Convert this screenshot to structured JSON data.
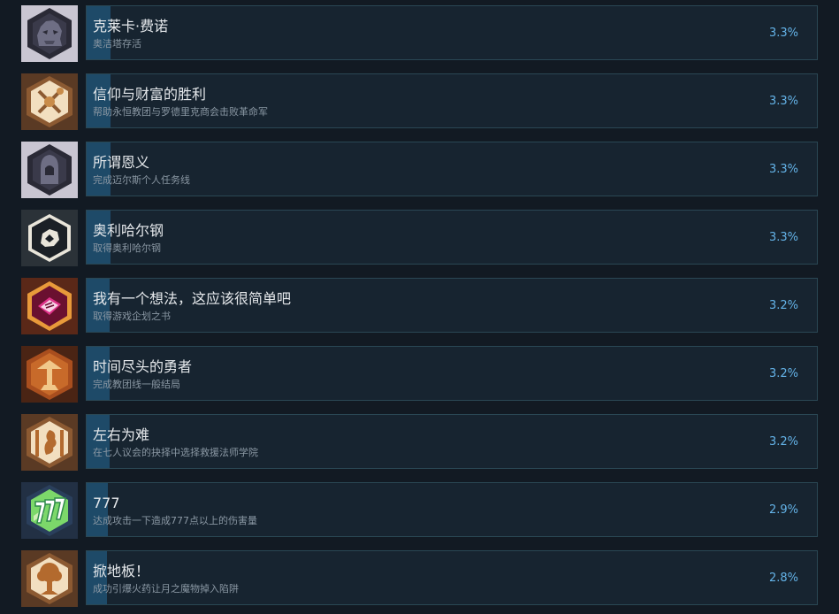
{
  "achievements": [
    {
      "title": "克莱卡·费诺",
      "description": "奥洁塔存活",
      "percent_label": "3.3%",
      "percent": 3.3,
      "icon": "creature-head-icon"
    },
    {
      "title": "信仰与财富的胜利",
      "description": "帮助永恒教团与罗德里克商会击败革命军",
      "percent_label": "3.3%",
      "percent": 3.3,
      "icon": "crossed-scepter-icon"
    },
    {
      "title": "所谓恩义",
      "description": "完成迈尔斯个人任务线",
      "percent_label": "3.3%",
      "percent": 3.3,
      "icon": "hooded-figure-icon"
    },
    {
      "title": "奥利哈尔钢",
      "description": "取得奥利哈尔钢",
      "percent_label": "3.3%",
      "percent": 3.3,
      "icon": "ore-chunk-icon"
    },
    {
      "title": "我有一个想法，这应该很简单吧",
      "description": "取得游戏企划之书",
      "percent_label": "3.2%",
      "percent": 3.2,
      "icon": "design-book-icon"
    },
    {
      "title": "时间尽头的勇者",
      "description": "完成教团线一般结局",
      "percent_label": "3.2%",
      "percent": 3.2,
      "icon": "tree-emblem-icon"
    },
    {
      "title": "左右为难",
      "description": "在七人议会的抉择中选择救援法师学院",
      "percent_label": "3.2%",
      "percent": 3.2,
      "icon": "dragon-banner-icon"
    },
    {
      "title": "777",
      "description": "达成攻击一下造成777点以上的伤害量",
      "percent_label": "2.9%",
      "percent": 2.9,
      "icon": "lucky-777-icon"
    },
    {
      "title": "掀地板！",
      "description": "成功引爆火药让月之魔物掉入陷阱",
      "percent_label": "2.8%",
      "percent": 2.8,
      "icon": "great-tree-icon"
    }
  ]
}
